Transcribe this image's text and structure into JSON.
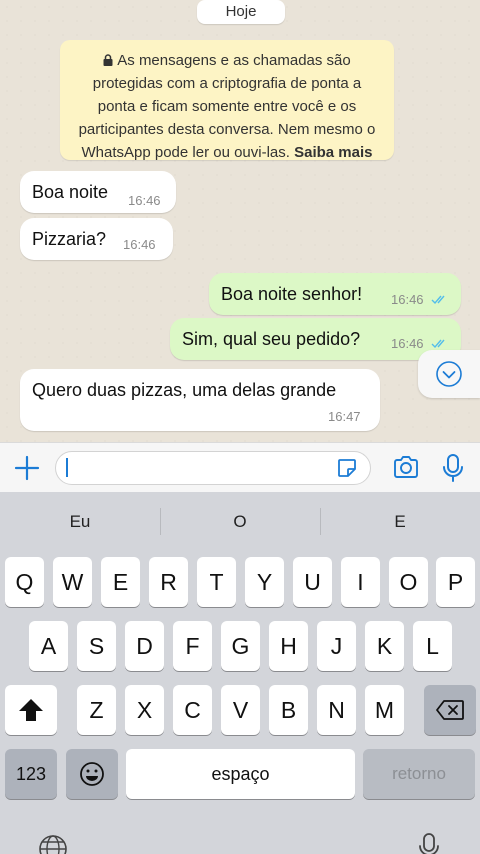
{
  "chat": {
    "date": "Hoje",
    "notice": {
      "text": "As mensagens e as chamadas são protegidas com a criptografia de ponta a ponta e ficam somente entre você e os participantes desta conversa. Nem mesmo o WhatsApp pode ler ou ouvi-las.",
      "link": "Saiba mais"
    },
    "messages": [
      {
        "direction": "in",
        "text": "Boa noite",
        "time": "16:46"
      },
      {
        "direction": "in",
        "text": "Pizzaria?",
        "time": "16:46"
      },
      {
        "direction": "out",
        "text": "Boa noite senhor!",
        "time": "16:46",
        "status": "read"
      },
      {
        "direction": "out",
        "text": "Sim, qual seu pedido?",
        "time": "16:46",
        "status": "read"
      },
      {
        "direction": "in",
        "text": "Quero duas pizzas, uma delas grande",
        "time": "16:47"
      }
    ]
  },
  "input": {
    "value": ""
  },
  "keyboard": {
    "suggestions": [
      "Eu",
      "O",
      "E"
    ],
    "row1": [
      "Q",
      "W",
      "E",
      "R",
      "T",
      "Y",
      "U",
      "I",
      "O",
      "P"
    ],
    "row2": [
      "A",
      "S",
      "D",
      "F",
      "G",
      "H",
      "J",
      "K",
      "L"
    ],
    "row3": [
      "Z",
      "X",
      "C",
      "V",
      "B",
      "N",
      "M"
    ],
    "numbers_label": "123",
    "space_label": "espaço",
    "return_label": "retorno"
  },
  "colors": {
    "outgoing_bubble": "#dcf8c6",
    "incoming_bubble": "#ffffff",
    "notice_bg": "#fdf4c5",
    "accent": "#1c7cd5",
    "read_ticks": "#53bdeb"
  }
}
